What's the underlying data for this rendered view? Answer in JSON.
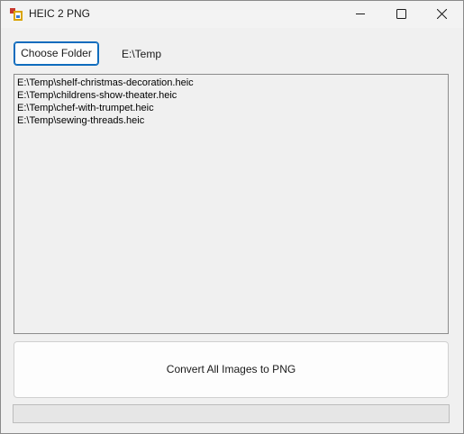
{
  "window": {
    "title": "HEIC 2 PNG",
    "app_icon": "app-icon"
  },
  "toolbar": {
    "choose_folder_label": "Choose Folder",
    "folder_path": "E:\\Temp"
  },
  "file_list": {
    "items": [
      "E:\\Temp\\shelf-christmas-decoration.heic",
      "E:\\Temp\\childrens-show-theater.heic",
      "E:\\Temp\\chef-with-trumpet.heic",
      "E:\\Temp\\sewing-threads.heic"
    ]
  },
  "actions": {
    "convert_label": "Convert All Images to PNG"
  },
  "progress": {
    "value": 0
  },
  "colors": {
    "accent": "#0f6cbd",
    "window_bg": "#f0f0f0"
  }
}
